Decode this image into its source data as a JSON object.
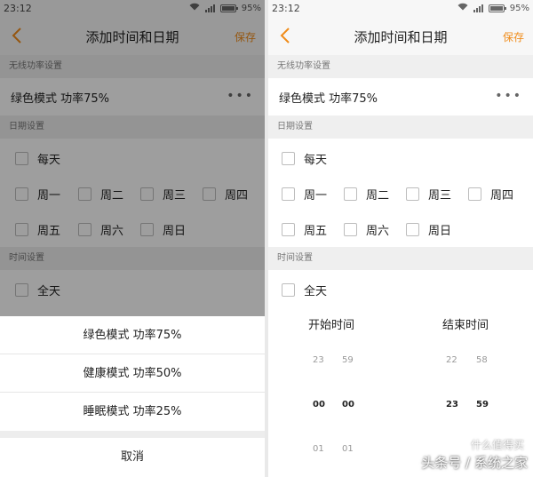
{
  "status": {
    "time": "23:12",
    "battery": "95%"
  },
  "nav": {
    "title": "添加时间和日期",
    "save": "保存"
  },
  "sections": {
    "wireless": "无线功率设置",
    "date": "日期设置",
    "time": "时间设置"
  },
  "power_mode": {
    "value": "绿色模式 功率75%",
    "more": "•••"
  },
  "date": {
    "every_day": "每天",
    "weekdays": [
      "周一",
      "周二",
      "周三",
      "周四",
      "周五",
      "周六",
      "周日"
    ]
  },
  "time": {
    "all_day": "全天"
  },
  "sheet": {
    "options": [
      "绿色模式 功率75%",
      "健康模式 功率50%",
      "睡眠模式 功率25%"
    ],
    "cancel": "取消"
  },
  "picker": {
    "start_label": "开始时间",
    "end_label": "结束时间",
    "start": {
      "prev": [
        "23",
        "59"
      ],
      "current": [
        "00",
        "00"
      ],
      "next": [
        "01",
        "01"
      ]
    },
    "end": {
      "prev": [
        "22",
        "58"
      ],
      "current": [
        "23",
        "59"
      ]
    }
  },
  "watermark": {
    "top": "什么值得买",
    "bottom": "头条号 / 系统之家"
  },
  "colors": {
    "accent": "#f08c1a",
    "section_bg": "#efefef",
    "overlay": "rgba(0,0,0,0.38)"
  }
}
